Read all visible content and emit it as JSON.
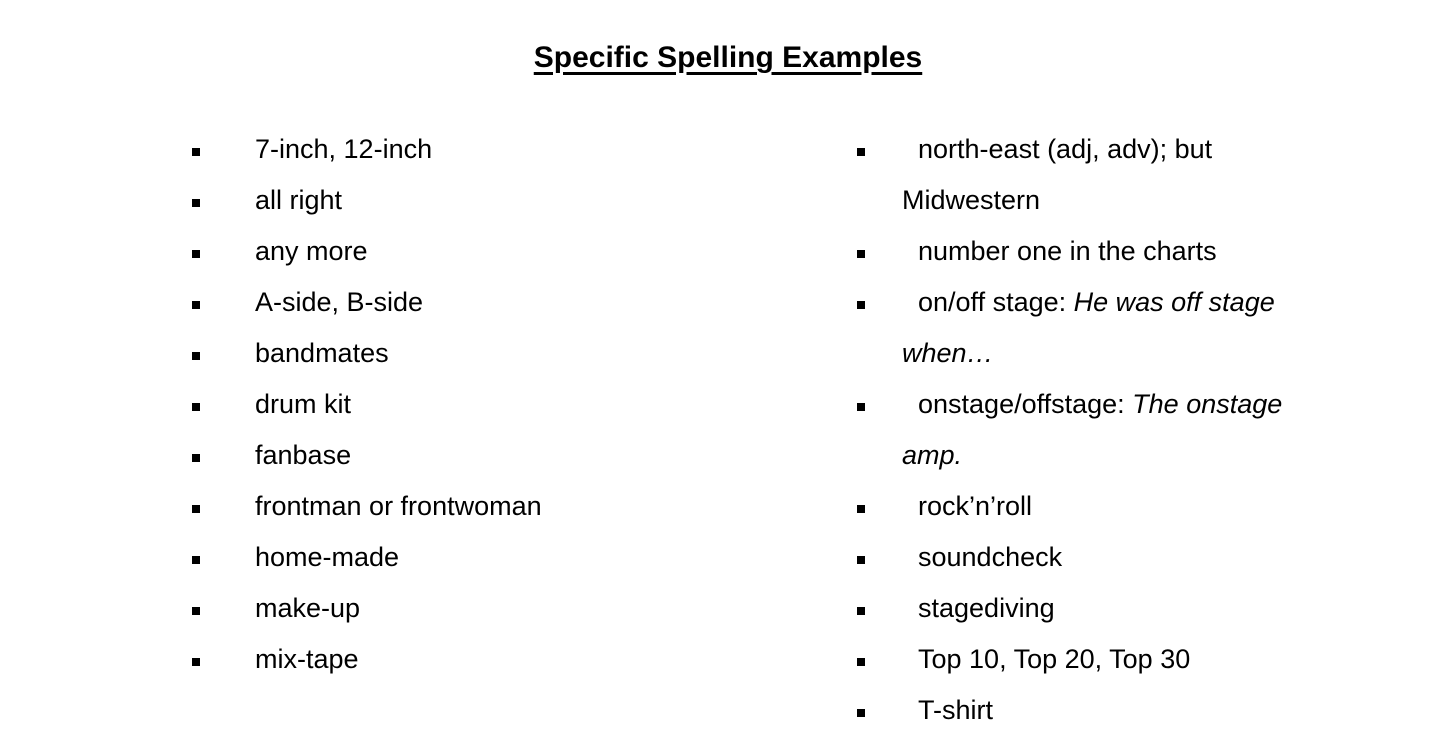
{
  "slide": {
    "title": "Specific Spelling Examples",
    "background_color": "#ffffff",
    "text_color": "#000000",
    "bullet_glyph": "filled-square"
  },
  "left_column": {
    "items": [
      {
        "text": "7-inch, 12-inch"
      },
      {
        "text": "all right"
      },
      {
        "text": "any more"
      },
      {
        "text": "A-side, B-side"
      },
      {
        "text": "bandmates"
      },
      {
        "text": "drum kit"
      },
      {
        "text": "fanbase"
      },
      {
        "text": "frontman or frontwoman"
      },
      {
        "text": "home-made"
      },
      {
        "text": "make-up"
      },
      {
        "text": "mix-tape"
      }
    ]
  },
  "right_column": {
    "items": [
      {
        "text": "north-east (adj, adv); but Midwestern",
        "plain": "north-east (adj, adv); but Midwestern",
        "italic": ""
      },
      {
        "text": "number one in the charts",
        "plain": "number one in the charts",
        "italic": ""
      },
      {
        "text": "on/off stage: He was off stage when…",
        "plain": "on/off stage: ",
        "italic": "He was off stage when…"
      },
      {
        "text": "onstage/offstage: The onstage amp.",
        "plain": "onstage/offstage: ",
        "italic": "The onstage amp."
      },
      {
        "text": "rock’n’roll",
        "plain": "rock’n’roll",
        "italic": ""
      },
      {
        "text": "soundcheck",
        "plain": "soundcheck",
        "italic": ""
      },
      {
        "text": "stagediving",
        "plain": "stagediving",
        "italic": ""
      },
      {
        "text": "Top 10, Top 20, Top 30",
        "plain": "Top 10, Top 20, Top 30",
        "italic": ""
      },
      {
        "text": "T-shirt",
        "plain": "T-shirt",
        "italic": ""
      }
    ]
  }
}
